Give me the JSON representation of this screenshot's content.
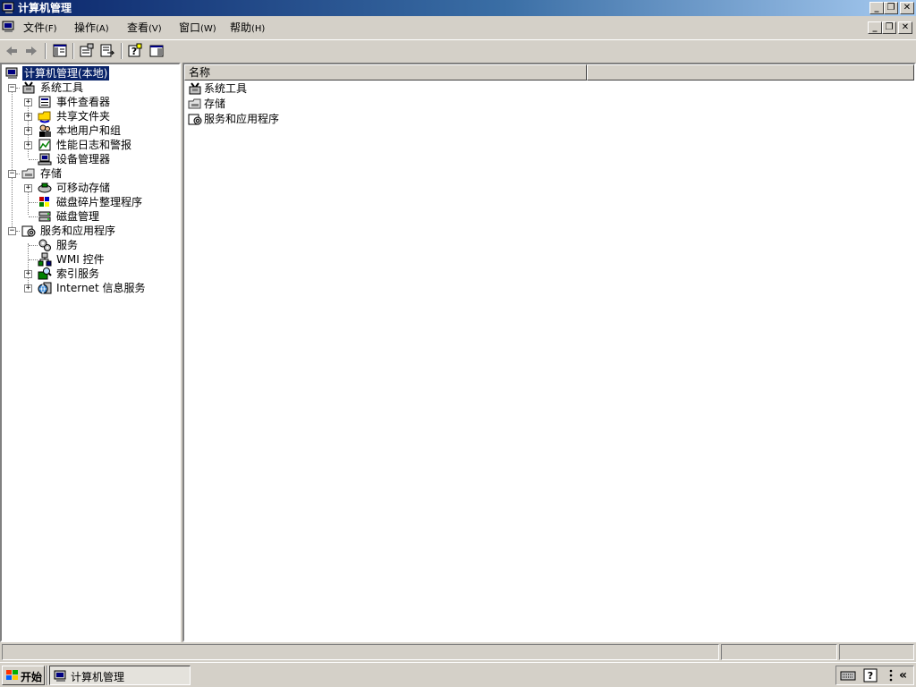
{
  "window": {
    "title": "计算机管理",
    "buttons": {
      "minimize": "_",
      "restore": "❐",
      "close": "✕"
    }
  },
  "menubar": {
    "items": [
      {
        "label": "文件",
        "key": "(F)"
      },
      {
        "label": "操作",
        "key": "(A)"
      },
      {
        "label": "查看",
        "key": "(V)"
      },
      {
        "label": "窗口",
        "key": "(W)"
      },
      {
        "label": "帮助",
        "key": "(H)"
      }
    ]
  },
  "toolbar": {
    "buttons": [
      "back-icon",
      "forward-icon",
      "show-hide-tree-icon",
      "properties-icon",
      "export-list-icon",
      "help-icon",
      "show-hide-action-pane-icon"
    ]
  },
  "tree": {
    "root": {
      "label": "计算机管理(本地)"
    },
    "system_tools": {
      "label": "系统工具",
      "children": [
        "事件查看器",
        "共享文件夹",
        "本地用户和组",
        "性能日志和警报",
        "设备管理器"
      ]
    },
    "storage": {
      "label": "存储",
      "children": [
        "可移动存储",
        "磁盘碎片整理程序",
        "磁盘管理"
      ]
    },
    "services_apps": {
      "label": "服务和应用程序",
      "children": [
        "服务",
        "WMI 控件",
        "索引服务",
        "Internet 信息服务"
      ]
    }
  },
  "list": {
    "columns": [
      "名称",
      ""
    ],
    "rows": [
      "系统工具",
      "存储",
      "服务和应用程序"
    ]
  },
  "taskbar": {
    "start_label": "开始",
    "task_label": "计算机管理",
    "tray_chevron": "«"
  },
  "colors": {
    "title_active": "#0a246a",
    "title_gradient_end": "#a6caf0",
    "face": "#d4d0c8",
    "selection": "#0a246a"
  }
}
